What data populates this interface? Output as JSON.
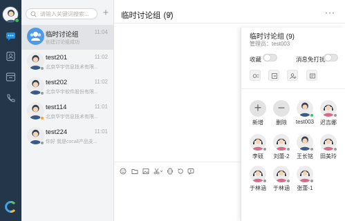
{
  "search": {
    "placeholder": "请输入关键词搜索..."
  },
  "conversations": [
    {
      "name": "临时讨论组",
      "time": "11:04",
      "preview": "创建讨论组成功",
      "type": "group",
      "status": "none"
    },
    {
      "name": "test201",
      "time": "11:02",
      "preview": "北京华宇信息技术有限...",
      "type": "user-male",
      "status": "offline"
    },
    {
      "name": "test202",
      "time": "11:02",
      "preview": "北京华宇软件股份有限...",
      "type": "user-male",
      "status": "offline"
    },
    {
      "name": "test114",
      "time": "11:01",
      "preview": "北京华宇信息技术有限...",
      "type": "user-male",
      "status": "away"
    },
    {
      "name": "test224",
      "time": "11:01",
      "preview": "你好 我是cocall产品支...",
      "type": "user-male",
      "status": "offline"
    }
  ],
  "chat": {
    "title": "临时讨论组",
    "count": "(9)"
  },
  "panel": {
    "title": "临时讨论组 (9)",
    "admin": "管理员：test003",
    "collect_label": "收藏",
    "dnd_label": "消息免打扰",
    "collect_on": false,
    "dnd_on": false
  },
  "members": [
    {
      "name": "新增",
      "kind": "add"
    },
    {
      "name": "删除",
      "kind": "remove"
    },
    {
      "name": "test003",
      "kind": "male",
      "status": "online"
    },
    {
      "name": "迟吉娜",
      "kind": "female",
      "status": "offline"
    },
    {
      "name": "李硕",
      "kind": "female",
      "status": "offline"
    },
    {
      "name": "刘蕾-2",
      "kind": "female",
      "status": "offline"
    },
    {
      "name": "王长铭",
      "kind": "male",
      "status": "offline"
    },
    {
      "name": "田美玲",
      "kind": "female",
      "status": "offline"
    },
    {
      "name": "于林涵",
      "kind": "female",
      "status": "offline"
    },
    {
      "name": "于林涵",
      "kind": "female",
      "status": "offline"
    },
    {
      "name": "张蕾-1",
      "kind": "female",
      "status": "offline"
    }
  ],
  "colors": {
    "rail": "#24364a",
    "accent": "#1a8fe3",
    "online": "#3cc45a",
    "away": "#ff9f2e"
  }
}
